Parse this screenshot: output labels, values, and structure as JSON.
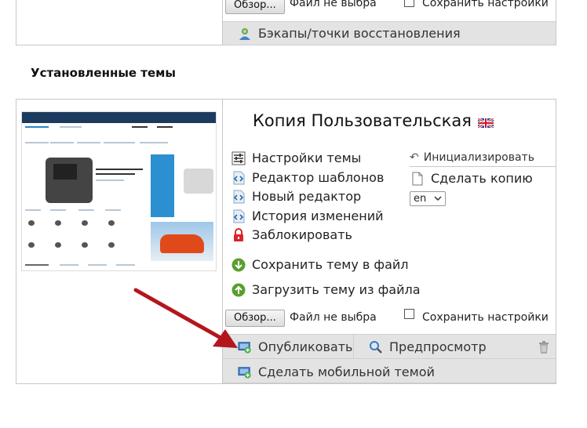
{
  "top_section": {
    "browse_button": "Обзор...",
    "file_status": "Файл не выбра",
    "save_settings_label": "Сохранить настройки",
    "backups_link": "Бэкапы/точки восстановления"
  },
  "installed_heading": "Установленные темы",
  "theme": {
    "title": "Копия Пользовательская",
    "menu": {
      "settings": "Настройки темы",
      "template_editor": "Редактор шаблонов",
      "new_editor": "Новый редактор",
      "history": "История изменений",
      "lock": "Заблокировать",
      "save_to_file": "Сохранить тему в файл",
      "load_from_file": "Загрузить тему из файла"
    },
    "initialize": "Инициализировать",
    "make_copy": "Сделать копию",
    "language_select": "en",
    "browse_button": "Обзор...",
    "file_status": "Файл не выбра",
    "save_settings_label": "Сохранить настройки",
    "publish": "Опубликовать",
    "preview": "Предпросмотр",
    "make_mobile": "Сделать мобильной темой"
  },
  "colors": {
    "arrow": "#b4161d",
    "bar_bg": "#e3e3e3",
    "lock_red": "#d9262b",
    "green_icon": "#4caf50"
  }
}
